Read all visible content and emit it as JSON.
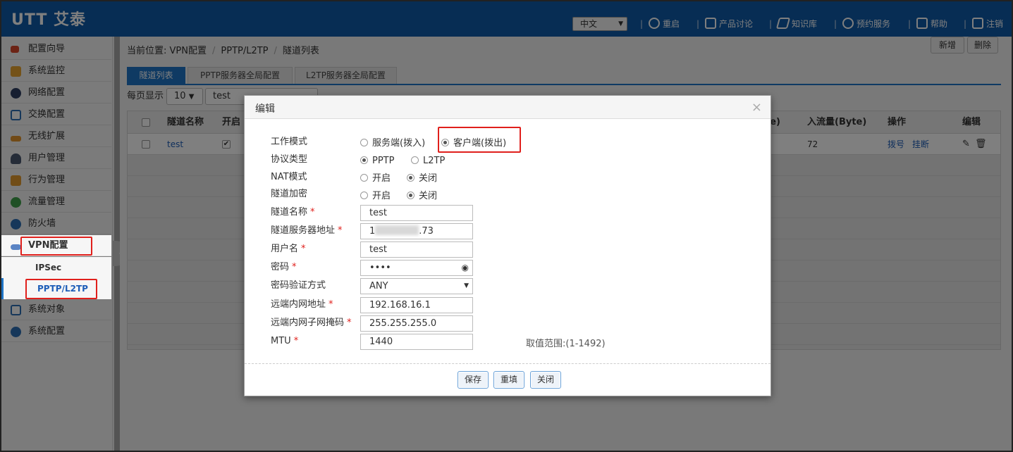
{
  "header": {
    "logo": "UTT 艾泰",
    "language": "中文",
    "nav": [
      {
        "label": "重启",
        "icon": "restart-icon"
      },
      {
        "label": "产品讨论",
        "icon": "chat-icon"
      },
      {
        "label": "知识库",
        "icon": "layers-icon"
      },
      {
        "label": "预约服务",
        "icon": "headset-icon"
      },
      {
        "label": "帮助",
        "icon": "help-icon"
      },
      {
        "label": "注销",
        "icon": "logout-icon"
      }
    ]
  },
  "sidebar": {
    "items": [
      {
        "label": "配置向导",
        "icon": "wizard-icon"
      },
      {
        "label": "系统监控",
        "icon": "monitor-icon"
      },
      {
        "label": "网络配置",
        "icon": "globe-icon"
      },
      {
        "label": "交换配置",
        "icon": "switch-icon"
      },
      {
        "label": "无线扩展",
        "icon": "wireless-icon"
      },
      {
        "label": "用户管理",
        "icon": "users-icon"
      },
      {
        "label": "行为管理",
        "icon": "hand-icon"
      },
      {
        "label": "流量管理",
        "icon": "traffic-icon"
      },
      {
        "label": "防火墙",
        "icon": "shield-icon"
      },
      {
        "label": "VPN配置",
        "icon": "vpn-icon"
      }
    ],
    "vpn_subitems": [
      {
        "label": "IPSec"
      },
      {
        "label": "PPTP/L2TP"
      }
    ],
    "items_after": [
      {
        "label": "系统对象",
        "icon": "cube-icon"
      },
      {
        "label": "系统配置",
        "icon": "gear-icon"
      }
    ]
  },
  "breadcrumb": {
    "prefix": "当前位置:",
    "parts": [
      "VPN配置",
      "PPTP/L2TP",
      "隧道列表"
    ]
  },
  "tabs": [
    {
      "label": "隧道列表",
      "active": true
    },
    {
      "label": "PPTP服务器全局配置",
      "active": false
    },
    {
      "label": "L2TP服务器全局配置",
      "active": false
    }
  ],
  "toolbar": {
    "per_page_label": "每页显示",
    "per_page_value": "10",
    "search_value": "test",
    "add_label": "新增",
    "delete_label": "删除"
  },
  "table": {
    "headers": {
      "name": "隧道名称",
      "enabled": "开启",
      "tx": "te)",
      "rx": "入流量(Byte)",
      "ops": "操作",
      "edit": "编辑"
    },
    "rows": [
      {
        "name": "test",
        "enabled": true,
        "rx": "72",
        "dial": "拨号",
        "hangup": "挂断"
      }
    ]
  },
  "modal": {
    "title": "编辑",
    "fields": {
      "work_mode_label": "工作模式",
      "work_mode_server": "服务端(拨入)",
      "work_mode_client": "客户端(拨出)",
      "protocol_label": "协议类型",
      "protocol_pptp": "PPTP",
      "protocol_l2tp": "L2TP",
      "nat_label": "NAT模式",
      "encrypt_label": "隧道加密",
      "on": "开启",
      "off": "关闭",
      "tunnel_name_label": "隧道名称",
      "tunnel_name_value": "test",
      "server_addr_label": "隧道服务器地址",
      "server_addr_prefix": "1",
      "server_addr_suffix": ".73",
      "username_label": "用户名",
      "username_value": "test",
      "password_label": "密码",
      "password_value": "••••",
      "auth_label": "密码验证方式",
      "auth_value": "ANY",
      "remote_net_label": "远端内网地址",
      "remote_net_value": "192.168.16.1",
      "remote_mask_label": "远端内网子网掩码",
      "remote_mask_value": "255.255.255.0",
      "mtu_label": "MTU",
      "mtu_value": "1440",
      "mtu_range": "取值范围:(1-1492)",
      "required_mark": "*"
    },
    "buttons": {
      "save": "保存",
      "reset": "重填",
      "close": "关闭"
    }
  },
  "colors": {
    "header_bg": "#0f5aa8",
    "accent": "#1e74c6",
    "highlight": "#e0201c"
  }
}
